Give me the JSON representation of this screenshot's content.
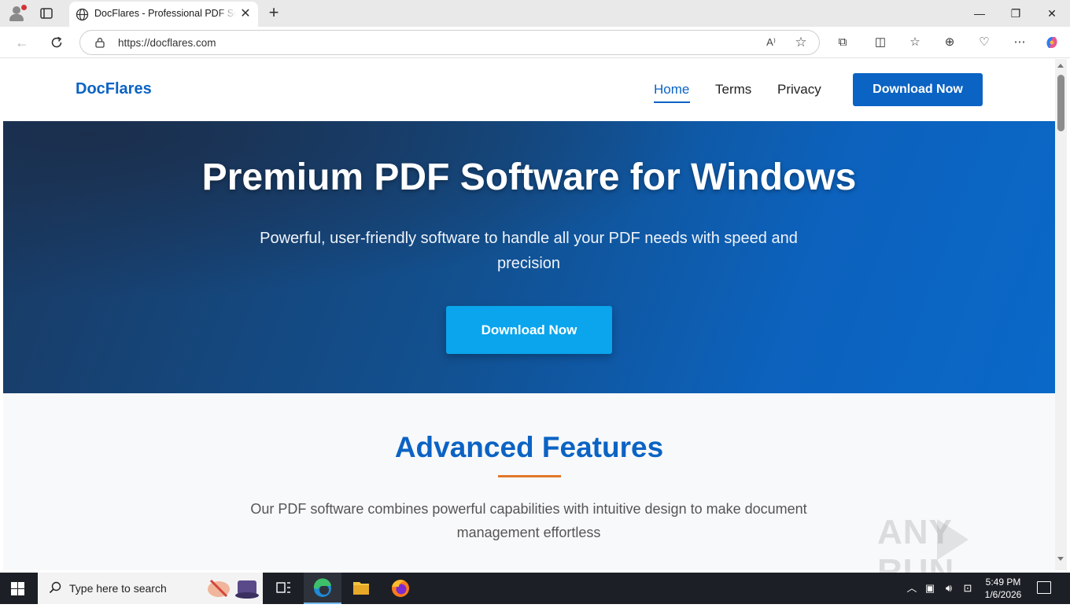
{
  "browser": {
    "tab_title": "DocFlares - Professional PDF Software",
    "close_tab": "✕",
    "new_tab": "+",
    "minimize": "—",
    "restore": "❐",
    "close_window": "✕",
    "url": "https://docflares.com",
    "read_aloud": "A⁾"
  },
  "site": {
    "logo": "DocFlares",
    "nav": [
      {
        "label": "Home"
      },
      {
        "label": "Terms"
      },
      {
        "label": "Privacy"
      }
    ],
    "header_cta": "Download Now"
  },
  "hero": {
    "title": "Premium PDF Software for Windows",
    "subtitle": "Powerful, user-friendly software to handle all your PDF needs with speed and precision",
    "cta": "Download Now"
  },
  "features": {
    "title": "Advanced Features",
    "description": "Our PDF software combines powerful capabilities with intuitive design to make document management effortless"
  },
  "watermark": "ANY RUN",
  "taskbar": {
    "search_placeholder": "Type here to search",
    "time": "5:49 PM",
    "date": "1/6/2026"
  },
  "colors": {
    "brand_blue": "#0b63c4",
    "hero_cta": "#0aa5ec",
    "accent_rule": "#e0782b"
  }
}
